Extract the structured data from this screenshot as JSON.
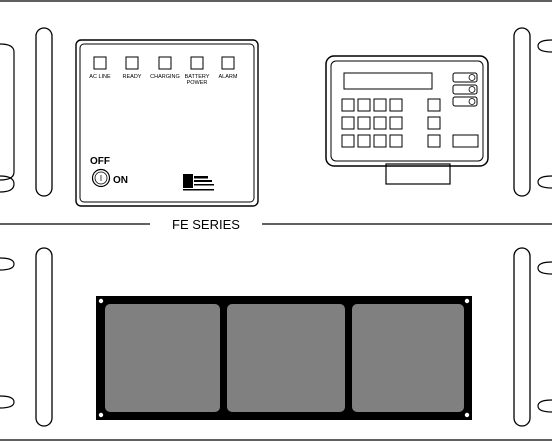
{
  "front_panel": {
    "series_label": "FE SERIES",
    "indicators": [
      {
        "label": "AC LINE"
      },
      {
        "label": "READY"
      },
      {
        "label": "CHARGING"
      },
      {
        "label": "BATTERY"
      },
      {
        "label": "ALARM"
      }
    ],
    "battery_second_line": "POWER",
    "switch": {
      "off_label": "OFF",
      "on_label": "ON",
      "symbol": "I"
    },
    "logo_text": "logo"
  },
  "colors": {
    "line": "#000000",
    "panel_bg": "#ffffff",
    "grille_frame": "#000000",
    "grille_fill": "#808080"
  }
}
